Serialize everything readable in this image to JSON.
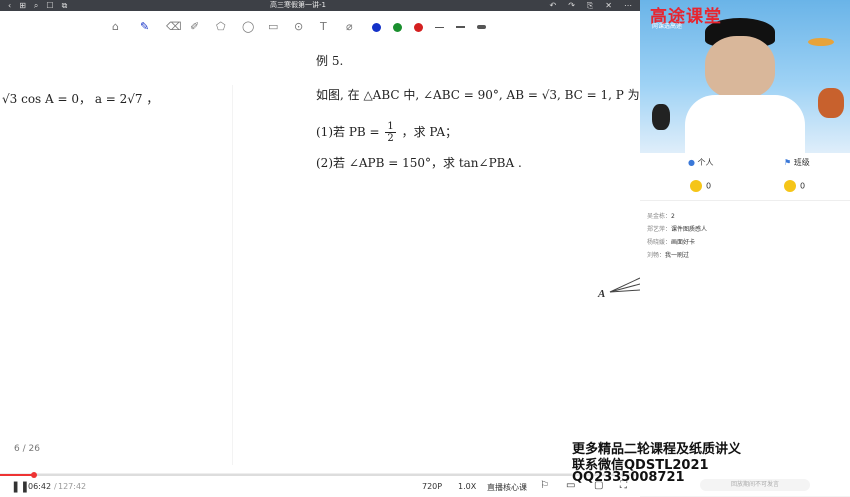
{
  "window": {
    "title": "高三寒假第一讲-1",
    "left_icons": [
      "‹",
      "⊞",
      "⌕",
      "☐",
      "⧉"
    ],
    "right_icons": [
      "↶",
      "↷",
      "⎘",
      "✕",
      "⋯"
    ]
  },
  "toolbar": {
    "tools": [
      "⌂",
      "✎",
      "⌫",
      "✐",
      "⬠",
      "◯",
      "▭",
      "⊙",
      "T",
      "⌀"
    ],
    "colors": [
      "#1432c8",
      "#1a8f2e",
      "#d42020"
    ]
  },
  "slide": {
    "left_line": "√3 cos A = 0， a = 2√7 ，",
    "example_title": "例 5.",
    "problem_line": "如图, 在 △ABC 中, ∠ABC = 90°, AB = √3, BC = 1, P 为 △",
    "part1_prefix": "(1)若 PB =",
    "part1_num": "1",
    "part1_den": "2",
    "part1_suffix": "，求 PA；",
    "part2": "(2)若 ∠APB = 150°，求 tan∠PBA .",
    "point_label": "A",
    "page_indicator": "6 / 26"
  },
  "player": {
    "time_current": "06:42",
    "time_total": "127:42",
    "quality": "720P",
    "speed": "1.0X",
    "mode": "直播核心课",
    "progress": 0.053
  },
  "video": {
    "brand": "高途课堂",
    "brand_sub": "网课选高途"
  },
  "side": {
    "tab_personal": "个人",
    "tab_class": "班级",
    "coins_personal": "0",
    "coins_class": "0",
    "messages": [
      {
        "name": "吴金栋：",
        "text": "2"
      },
      {
        "name": "郑艺萍：",
        "text": "课件图质感人"
      },
      {
        "name": "杨晓媛：",
        "text": "画面好卡"
      },
      {
        "name": "刘畅：",
        "text": "我一刷过"
      }
    ],
    "input_placeholder": "回放期间不可发言"
  },
  "watermark": {
    "line1": "更多精品二轮课程及纸质讲义",
    "line2": "联系微信QDSTL2021",
    "line3": "QQ2335008721"
  }
}
